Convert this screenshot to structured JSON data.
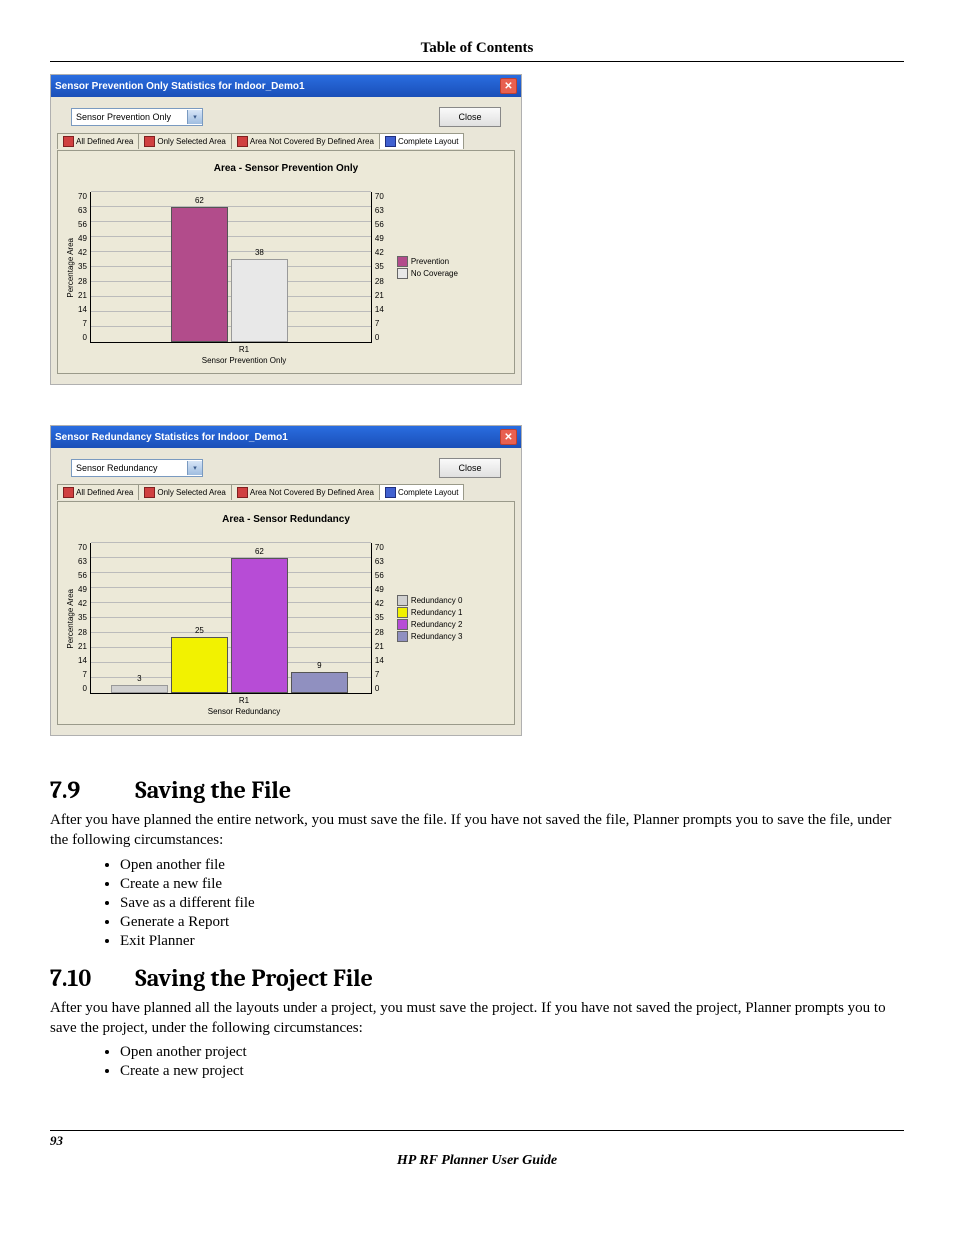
{
  "header": {
    "toc": "Table of Contents"
  },
  "dialog1": {
    "title": "Sensor Prevention Only Statistics for Indoor_Demo1",
    "select_value": "Sensor Prevention Only",
    "close_btn": "Close",
    "tabs": [
      "All Defined Area",
      "Only Selected Area",
      "Area Not Covered By Defined Area",
      "Complete Layout"
    ],
    "chart_title": "Area - Sensor Prevention Only",
    "yaxis_label": "Percentage Area",
    "xaxis_cat": "R1",
    "xaxis_title": "Sensor Prevention Only",
    "legend": [
      "Prevention",
      "No Coverage"
    ]
  },
  "dialog2": {
    "title": "Sensor Redundancy Statistics for Indoor_Demo1",
    "select_value": "Sensor Redundancy",
    "close_btn": "Close",
    "tabs": [
      "All Defined Area",
      "Only Selected Area",
      "Area Not Covered By Defined Area",
      "Complete Layout"
    ],
    "chart_title": "Area - Sensor Redundancy",
    "yaxis_label": "Percentage Area",
    "xaxis_cat": "R1",
    "xaxis_title": "Sensor Redundancy",
    "legend": [
      "Redundancy 0",
      "Redundancy 1",
      "Redundancy 2",
      "Redundancy 3"
    ]
  },
  "section79": {
    "num": "7.9",
    "title": "Saving the File",
    "para": "After you have planned the entire network, you must save the file. If you have not saved the file, Planner prompts you to save the file, under the following circumstances:",
    "bullets": [
      "Open another file",
      "Create a new file",
      "Save as a different file",
      "Generate a Report",
      "Exit Planner"
    ]
  },
  "section710": {
    "num": "7.10",
    "title": "Saving the Project File",
    "para": "After you have planned all the layouts under a project, you must save the project. If you have not saved the project, Planner prompts you to save the project, under the following circumstances:",
    "bullets": [
      "Open another project",
      "Create a new project"
    ]
  },
  "footer": {
    "page": "93",
    "guide": "HP RF Planner User Guide"
  },
  "chart_data": [
    {
      "type": "bar",
      "title": "Area - Sensor Prevention Only",
      "xlabel": "Sensor Prevention Only",
      "ylabel": "Percentage Area",
      "categories": [
        "R1"
      ],
      "yticks": [
        0,
        7,
        14,
        21,
        28,
        35,
        42,
        49,
        56,
        63,
        70
      ],
      "ylim": [
        0,
        70
      ],
      "series": [
        {
          "name": "Prevention",
          "values": [
            62
          ],
          "color": "#b24c8b"
        },
        {
          "name": "No Coverage",
          "values": [
            38
          ],
          "color": "#e8e8e8"
        }
      ]
    },
    {
      "type": "bar",
      "title": "Area - Sensor Redundancy",
      "xlabel": "Sensor Redundancy",
      "ylabel": "Percentage Area",
      "categories": [
        "R1"
      ],
      "yticks": [
        0,
        7,
        14,
        21,
        28,
        35,
        42,
        49,
        56,
        63,
        70
      ],
      "ylim": [
        0,
        70
      ],
      "series": [
        {
          "name": "Redundancy 0",
          "values": [
            3
          ],
          "color": "#d0d0d0"
        },
        {
          "name": "Redundancy 1",
          "values": [
            25
          ],
          "color": "#f2f200"
        },
        {
          "name": "Redundancy 2",
          "values": [
            62
          ],
          "color": "#b74cd6"
        },
        {
          "name": "Redundancy 3",
          "values": [
            9
          ],
          "color": "#9090c0"
        }
      ]
    }
  ]
}
